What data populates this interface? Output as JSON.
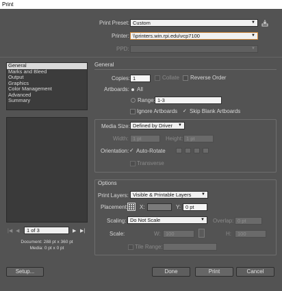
{
  "window": {
    "title": "Print"
  },
  "header": {
    "preset_label": "Print Preset:",
    "preset_value": "Custom",
    "printer_label": "Printer:",
    "printer_value": "\\\\printers.win.rpi.edu\\vcp7100",
    "ppd_label": "PPD:",
    "ppd_value": ""
  },
  "sidebar": {
    "items": [
      {
        "label": "General",
        "selected": true
      },
      {
        "label": "Marks and Bleed"
      },
      {
        "label": "Output"
      },
      {
        "label": "Graphics"
      },
      {
        "label": "Color Management"
      },
      {
        "label": "Advanced"
      },
      {
        "label": "Summary"
      }
    ]
  },
  "preview": {
    "page_value": "1 of 3",
    "document_info": "Document: 288 pt x 360 pt",
    "media_info": "Media: 0 pt x 0 pt"
  },
  "general": {
    "title": "General",
    "copies_label": "Copies:",
    "copies_value": "1",
    "collate_label": "Collate",
    "reverse_order_label": "Reverse Order",
    "artboards_label": "Artboards:",
    "all_label": "All",
    "range_label": "Range:",
    "range_value": "1-3",
    "ignore_artboards_label": "Ignore Artboards",
    "skip_blank_label": "Skip Blank Artboards"
  },
  "media": {
    "size_label": "Media Size:",
    "size_value": "Defined by Driver",
    "width_label": "Width:",
    "width_value": "1 pt",
    "height_label": "Height:",
    "height_value": "1 pt",
    "orientation_label": "Orientation:",
    "auto_rotate_label": "Auto-Rotate",
    "transverse_label": "Transverse"
  },
  "options": {
    "title": "Options",
    "print_layers_label": "Print Layers:",
    "print_layers_value": "Visible & Printable Layers",
    "placement_label": "Placement:",
    "x_label": "X:",
    "x_value": "",
    "y_label": "Y:",
    "y_value": "0 pt",
    "scaling_label": "Scaling:",
    "scaling_value": "Do Not Scale",
    "overlap_label": "Overlap:",
    "overlap_value": "0 pt",
    "scale_label": "Scale:",
    "w_label": "W:",
    "w_value": "100",
    "h_label": "H:",
    "h_value": "100",
    "tile_range_label": "Tile Range:",
    "tile_range_value": ""
  },
  "footer": {
    "setup_label": "Setup...",
    "done_label": "Done",
    "print_label": "Print",
    "cancel_label": "Cancel"
  }
}
